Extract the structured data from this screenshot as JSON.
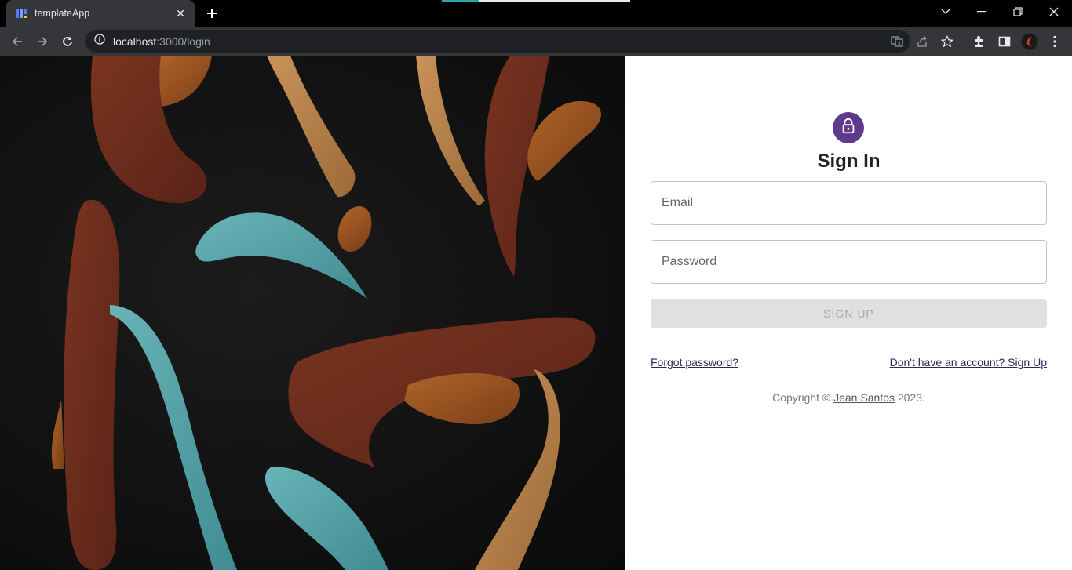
{
  "browser": {
    "tab_title": "templateApp",
    "url_host": "localhost",
    "url_path": ":3000/login",
    "profile_initial": "€"
  },
  "signin": {
    "title": "Sign In",
    "email_placeholder": "Email",
    "password_placeholder": "Password",
    "submit_label": "SIGN UP",
    "forgot_link": "Forgot password?",
    "signup_link": "Don't have an account? Sign Up",
    "copyright_prefix": "Copyright ©",
    "copyright_author": "Jean Santos",
    "copyright_year": "2023."
  },
  "colors": {
    "avatar_bg": "#5e3a8a",
    "button_disabled_bg": "#e0e0e0"
  }
}
